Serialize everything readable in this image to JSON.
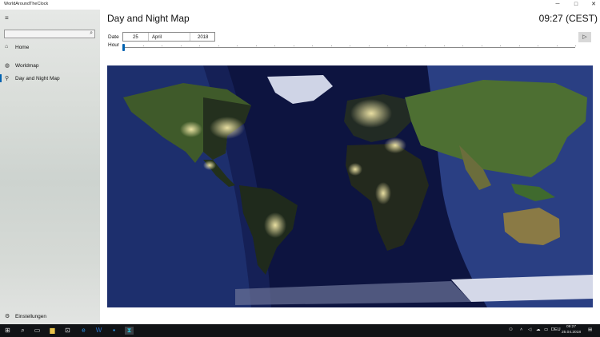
{
  "window": {
    "title": "WorldAroundTheClock",
    "minimize": "─",
    "maximize": "□",
    "close": "✕"
  },
  "sidebar": {
    "menu_icon": "≡",
    "search": {
      "placeholder": "",
      "icon": "⌕"
    },
    "items": [
      {
        "label": "Home",
        "icon": "⌂",
        "selected": false
      },
      {
        "label": "Worldmap",
        "icon": "◍",
        "selected": false
      },
      {
        "label": "Day and Night Map",
        "icon": "⚲",
        "selected": true
      }
    ],
    "settings": {
      "label": "Einstellungen",
      "icon": "⚙"
    }
  },
  "main": {
    "title": "Day and Night Map",
    "clock": "09:27 (CEST)",
    "date": {
      "label": "Date",
      "day": "25",
      "month": "April",
      "year": "2018"
    },
    "hour": {
      "label": "Hour",
      "value_fraction": 0.0
    },
    "play_icon": "▷"
  },
  "taskbar": {
    "icons": [
      "start-icon",
      "search-icon",
      "task-view-icon",
      "file-explorer-icon",
      "store-icon",
      "edge-icon",
      "word-icon",
      "photoshop-icon",
      "app-icon"
    ],
    "tray_lang": "DEU",
    "time": "09:27",
    "date": "25.04.2018"
  },
  "colors": {
    "accent": "#0063b1",
    "ocean_night": "#0d1440",
    "ocean_day": "#1d2f6d",
    "land_day": "#4a6e2f"
  }
}
